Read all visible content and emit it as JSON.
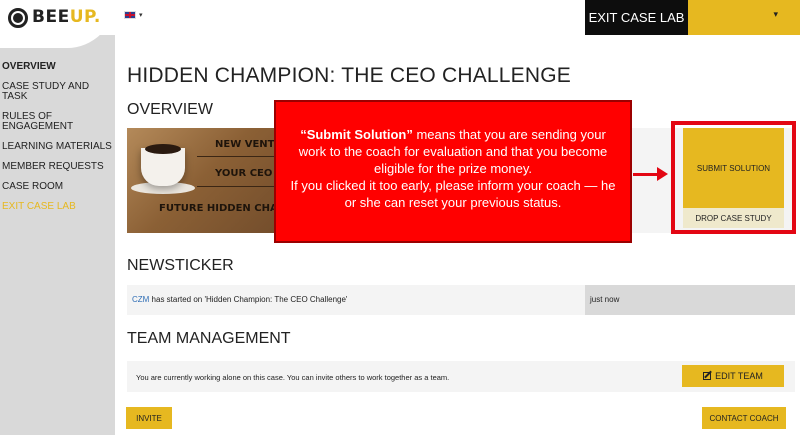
{
  "header": {
    "logo_text": "BEE",
    "logo_accent": "UP.",
    "exit_label": "EXIT CASE LAB",
    "user_menu_caret": "▾",
    "language_caret": "▾"
  },
  "sidebar": {
    "items": [
      {
        "label": "OVERVIEW"
      },
      {
        "label": "CASE STUDY AND TASK"
      },
      {
        "label": "RULES OF ENGAGEMENT"
      },
      {
        "label": "LEARNING MATERIALS"
      },
      {
        "label": "MEMBER REQUESTS"
      },
      {
        "label": "CASE ROOM"
      },
      {
        "label": "EXIT CASE LAB"
      }
    ]
  },
  "main": {
    "title": "HIDDEN CHAMPION: THE CEO CHALLENGE",
    "overview_heading": "OVERVIEW",
    "hero_lines": [
      "NEW VENTU",
      "YOUR CEO RO",
      "FUTURE HIDDEN CHAMPIO"
    ],
    "submit_label": "SUBMIT SOLUTION",
    "drop_label": "DROP CASE STUDY",
    "newsticker_heading": "NEWSTICKER",
    "news": {
      "user": "CZM",
      "text": " has started on 'Hidden Champion: The CEO Challenge'",
      "time": "just now"
    },
    "team_heading": "TEAM MANAGEMENT",
    "team_text": "You are currently working alone on this case. You can invite others to work together as a team.",
    "edit_team_label": "EDIT TEAM",
    "invite_label": "INVITE",
    "contact_label": "CONTACT COACH"
  },
  "callout": {
    "bold_prefix": "“Submit Solution”",
    "text_1": " means that you are sending your work to the coach for evaluation and that you become eligible for the prize money.",
    "text_2": "If you clicked it too early, please inform your coach — he or she can reset your previous status."
  },
  "colors": {
    "accent": "#e6b820",
    "sidebar_bg": "#d9d9d9",
    "callout_bg": "#ff0000",
    "highlight": "#e30613",
    "link": "#2f6eb5"
  },
  "icons": {
    "logo": "bee-logo-icon",
    "language": "uk-flag-icon",
    "edit": "edit-icon"
  }
}
